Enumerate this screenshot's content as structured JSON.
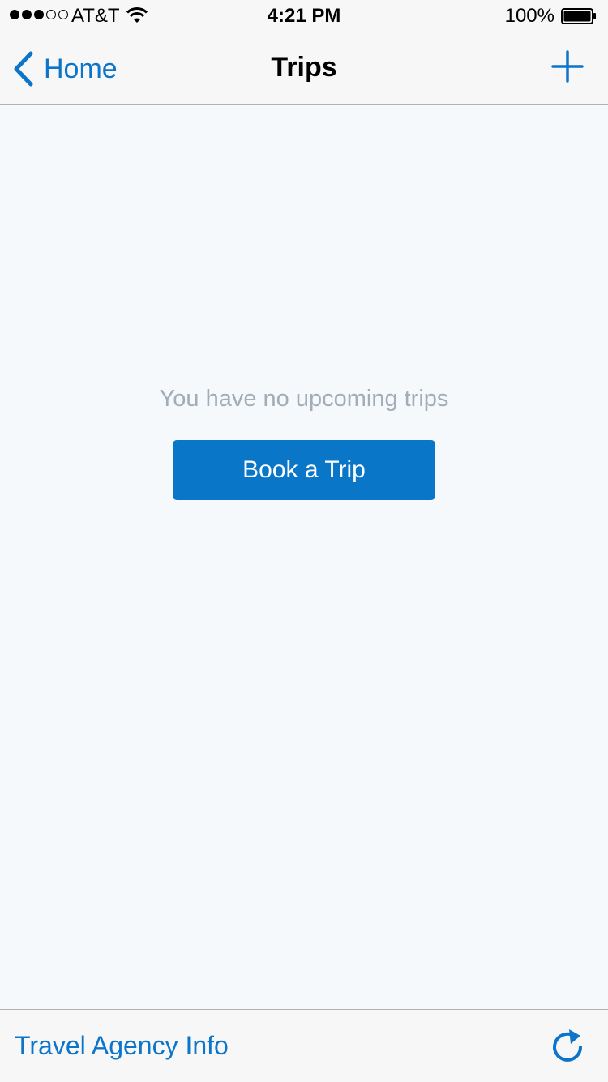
{
  "status_bar": {
    "carrier": "AT&T",
    "time": "4:21 PM",
    "battery": "100%",
    "signal_bars_filled": 3,
    "signal_bars_total": 5,
    "wifi_icon": "wifi-icon",
    "battery_icon": "battery-full-icon"
  },
  "nav": {
    "back_label": "Home",
    "title": "Trips",
    "back_icon": "chevron-left-icon",
    "add_icon": "plus-icon"
  },
  "main": {
    "empty_message": "You have no upcoming trips",
    "book_button": "Book a Trip"
  },
  "toolbar": {
    "agency_info": "Travel Agency Info",
    "refresh_icon": "refresh-icon"
  },
  "colors": {
    "accent": "#0d75c9",
    "button_bg": "#0a76c8",
    "background": "#f6f9fc",
    "muted_text": "#a3adb8"
  }
}
